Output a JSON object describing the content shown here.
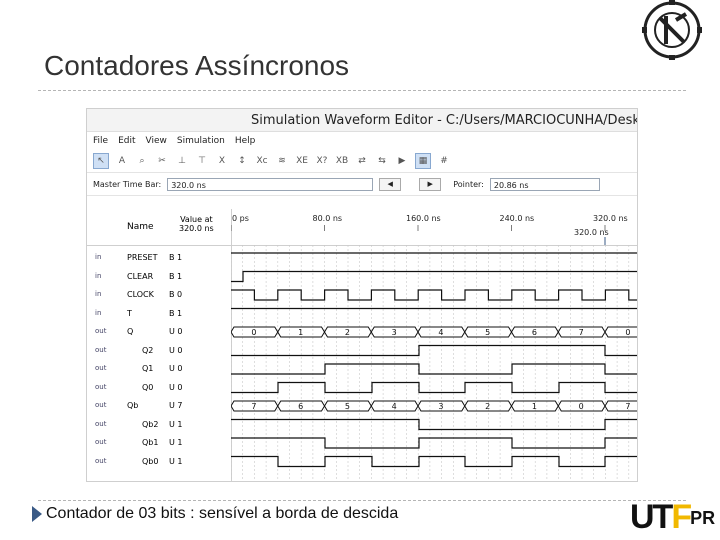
{
  "slide": {
    "title": "Contadores Assíncronos",
    "caption": "Contador de 03 bits : sensível a borda de descida",
    "footer_logo": "UTFPR"
  },
  "window": {
    "title": "Simulation Waveform Editor - C:/Users/MARCIOCUNHA/Desktop",
    "menu": [
      "File",
      "Edit",
      "View",
      "Simulation",
      "Help"
    ],
    "master_time_bar_label": "Master Time Bar:",
    "master_time_bar_value": "320.0 ns",
    "pointer_label": "Pointer:",
    "pointer_value": "20.86 ns"
  },
  "table": {
    "name_header": "Name",
    "value_header_line1": "Value at",
    "value_header_line2": "320.0 ns",
    "time_ticks": [
      "0 ps",
      "80.0 ns",
      "160.0 ns",
      "240.0 ns",
      "320.0 ns"
    ],
    "cursor_label": "320.0 ns",
    "rows": [
      {
        "name": "PRESET",
        "value": "B 1",
        "icon": "input-pin-icon"
      },
      {
        "name": "CLEAR",
        "value": "B 1",
        "icon": "input-pin-icon"
      },
      {
        "name": "CLOCK",
        "value": "B 0",
        "icon": "input-pin-icon"
      },
      {
        "name": "T",
        "value": "B 1",
        "icon": "input-pin-icon"
      },
      {
        "name": "Q",
        "value": "U 0",
        "icon": "output-bus-icon"
      },
      {
        "name": "Q2",
        "value": "U 0",
        "icon": "output-pin-icon"
      },
      {
        "name": "Q1",
        "value": "U 0",
        "icon": "output-pin-icon"
      },
      {
        "name": "Q0",
        "value": "U 0",
        "icon": "output-pin-icon"
      },
      {
        "name": "Qb",
        "value": "U 7",
        "icon": "output-bus-icon"
      },
      {
        "name": "Qb2",
        "value": "U 1",
        "icon": "output-pin-icon"
      },
      {
        "name": "Qb1",
        "value": "U 1",
        "icon": "output-pin-icon"
      },
      {
        "name": "Qb0",
        "value": "U 1",
        "icon": "output-pin-icon"
      }
    ],
    "q_bus_values": [
      "0",
      "1",
      "2",
      "3",
      "4",
      "5",
      "6",
      "7",
      "0"
    ],
    "qb_bus_values": [
      "7",
      "6",
      "5",
      "4",
      "3",
      "2",
      "1",
      "0",
      "7"
    ]
  }
}
